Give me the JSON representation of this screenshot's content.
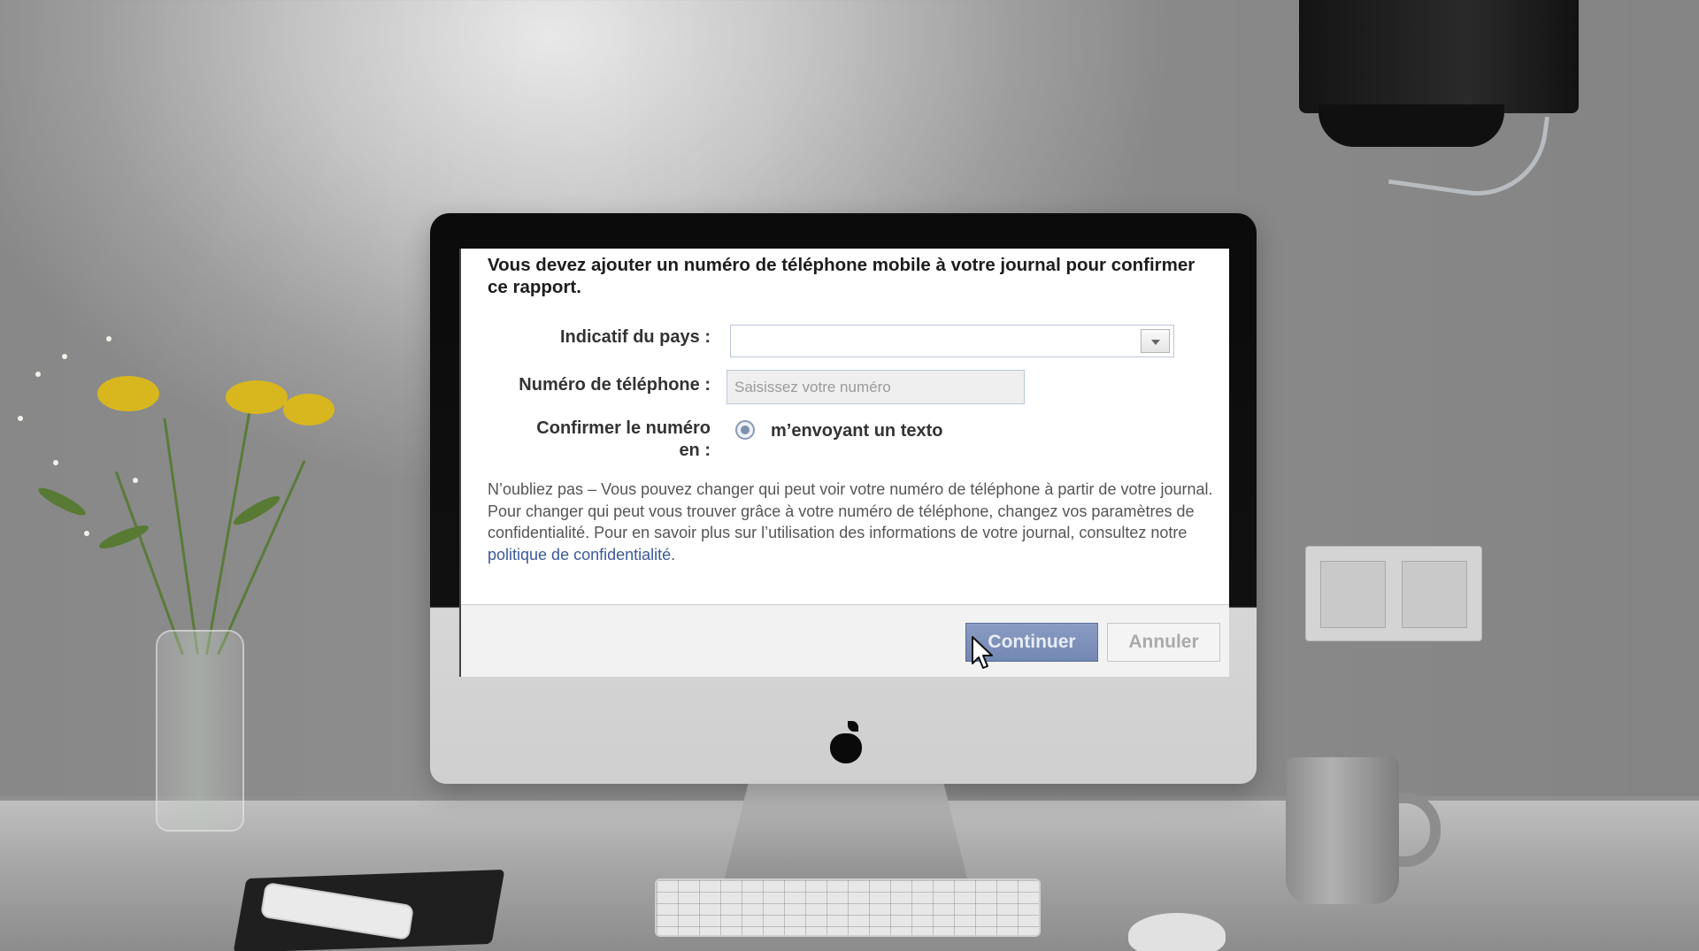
{
  "dialog": {
    "title": "Vous devez ajouter un numéro de téléphone mobile à votre journal pour confirmer ce rapport.",
    "country_label": "Indicatif du pays :",
    "country_value": "",
    "phone_label": "Numéro de téléphone :",
    "phone_placeholder": "Saisissez votre numéro",
    "confirm_label_line1": "Confirmer le numéro",
    "confirm_label_line2": "en :",
    "radio_option": "m’envoyant un texto",
    "notice_text": "N’oubliez pas – Vous pouvez changer qui peut voir votre numéro de téléphone à partir de votre journal. Pour changer qui peut vous trouver grâce à votre numéro de téléphone, changez vos paramètres de confidentialité. Pour en savoir plus sur l’utilisation des informations de votre journal, consultez notre ",
    "notice_link": "politique de confidentialité",
    "notice_end": ".",
    "continue_label": "Continuer",
    "cancel_label": "Annuler"
  },
  "colors": {
    "link": "#3b5998",
    "primary_button": "#7d90b8",
    "footer_bg": "#f2f2f2"
  },
  "icons": {
    "dropdown": "chevron-down-icon",
    "cursor": "mouse-pointer-icon",
    "brand": "apple-logo-icon"
  }
}
